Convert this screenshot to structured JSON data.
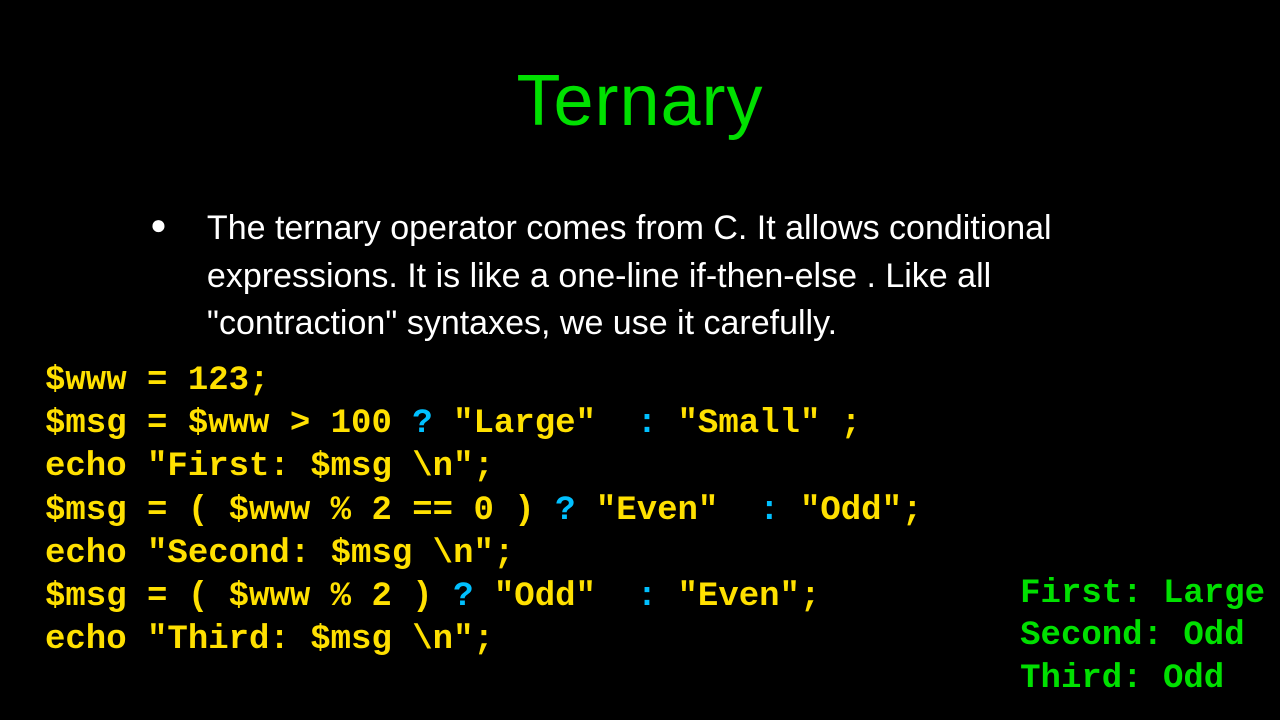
{
  "title": "Ternary",
  "bullet": "The ternary operator comes from C.   It allows conditional expressions.  It is like a one-line if-then-else .  Like all \"contraction\" syntaxes, we use it carefully.",
  "code": {
    "l1": "$www = 123;",
    "l2a": "$msg = $www > 100 ",
    "l2q": "?",
    "l2b": " \"Large\"  ",
    "l2c": ":",
    "l2d": " \"Small\" ;",
    "l3": "echo \"First: $msg \\n\";",
    "l4a": "$msg = ( $www % 2 == 0 ) ",
    "l4q": "?",
    "l4b": " \"Even\"  ",
    "l4c": ":",
    "l4d": " \"Odd\";",
    "l5": "echo \"Second: $msg \\n\";",
    "l6a": "$msg = ( $www % 2 ) ",
    "l6q": "?",
    "l6b": " \"Odd\"  ",
    "l6c": ":",
    "l6d": " \"Even\";",
    "l7": "echo \"Third: $msg \\n\";"
  },
  "output": {
    "o1": "First: Large",
    "o2": "Second: Odd",
    "o3": "Third: Odd"
  }
}
